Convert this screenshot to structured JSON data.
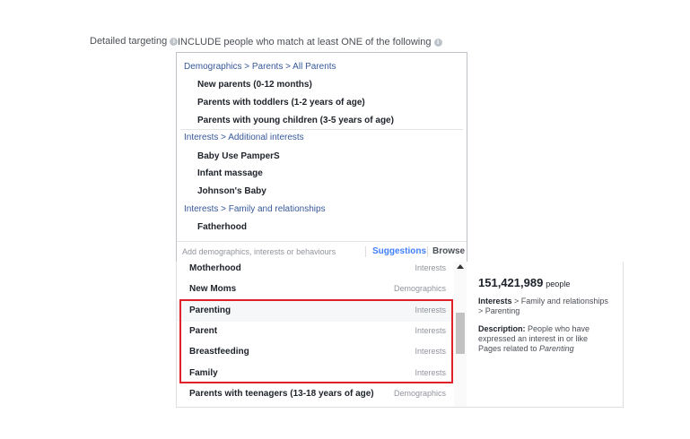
{
  "header": {
    "label": "Detailed targeting",
    "include_prefix": "INCLUDE",
    "include_rest": "people who match at least ONE of the following"
  },
  "selected": {
    "groups": [
      {
        "category": "Demographics > Parents > All Parents",
        "items": [
          "New parents (0-12 months)",
          "Parents with toddlers (1-2 years of age)",
          "Parents with young children (3-5 years of age)"
        ]
      },
      {
        "category": "Interests > Additional interests",
        "items": [
          "Baby Use PamperS",
          "Infant massage",
          "Johnson's Baby"
        ]
      },
      {
        "category": "Interests > Family and relationships",
        "items": [
          "Fatherhood"
        ]
      }
    ]
  },
  "search": {
    "placeholder": "Add demographics, interests or behaviours",
    "tab_suggestions": "Suggestions",
    "tab_browse": "Browse"
  },
  "suggestions": [
    {
      "name": "Motherhood",
      "type": "Interests"
    },
    {
      "name": "New Moms",
      "type": "Demographics"
    },
    {
      "name": "Parenting",
      "type": "Interests"
    },
    {
      "name": "Parent",
      "type": "Interests"
    },
    {
      "name": "Breastfeeding",
      "type": "Interests"
    },
    {
      "name": "Family",
      "type": "Interests"
    },
    {
      "name": "Parents with teenagers (13-18 years of age)",
      "type": "Demographics"
    }
  ],
  "info": {
    "count": "151,421,989",
    "count_unit": "people",
    "path_label": "Interests",
    "path_rest": " > Family and relationships > Parenting",
    "desc_label": "Description:",
    "desc_text": " People who have expressed an interest in or like Pages related to ",
    "desc_topic": "Parenting"
  },
  "colors": {
    "link": "#365899",
    "accent": "#4080ff",
    "highlight_border": "#e0202a"
  }
}
